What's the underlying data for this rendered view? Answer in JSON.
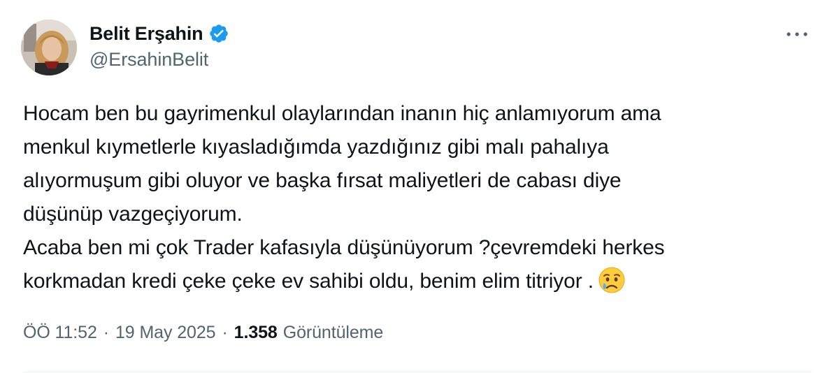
{
  "author": {
    "display_name": "Belit Erşahin",
    "handle": "@ErsahinBelit",
    "verified": true,
    "verified_color": "#1d9bf0"
  },
  "tweet": {
    "lines": [
      "Hocam ben bu gayrimenkul olaylarından inanın hiç anlamıyorum ama",
      "menkul kıymetlerle kıyasladığımda yazdığınız gibi malı pahalıya",
      "alıyormuşum gibi oluyor ve başka fırsat maliyetleri de cabası diye",
      "düşünüp vazgeçiyorum.",
      "Acaba ben mi çok Trader kafasıyla düşünüyorum ?çevremdeki herkes",
      "korkmadan kredi çeke çeke ev sahibi oldu, benim elim titriyor ."
    ],
    "emoji": "sad-but-relieved-face-icon"
  },
  "meta": {
    "time": "ÖÖ 11:52",
    "separator": "·",
    "date": "19 May 2025",
    "views_count": "1.358",
    "views_label": "Görüntüleme"
  },
  "icons": {
    "more": "more-horizontal-icon",
    "verified": "verified-badge-icon"
  }
}
